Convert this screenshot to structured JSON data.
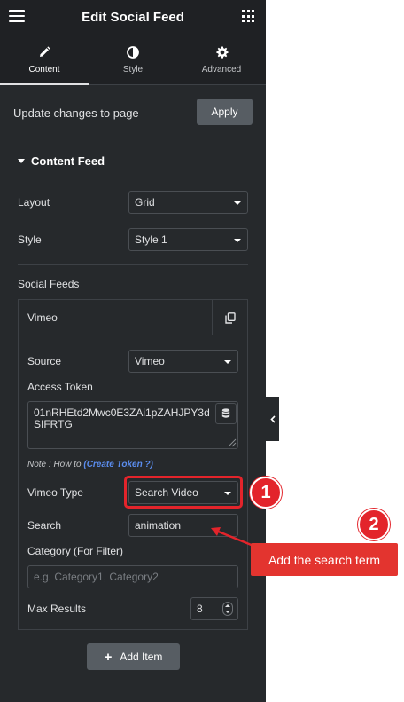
{
  "header": {
    "title": "Edit Social Feed",
    "menu_icon": "hamburger-icon",
    "apps_icon": "grid-icon"
  },
  "tabs": [
    {
      "label": "Content",
      "icon": "pencil-icon",
      "active": true
    },
    {
      "label": "Style",
      "icon": "half-circle-icon",
      "active": false
    },
    {
      "label": "Advanced",
      "icon": "gear-icon",
      "active": false
    }
  ],
  "update": {
    "text": "Update changes to page",
    "button": "Apply"
  },
  "section": {
    "title": "Content Feed"
  },
  "layout": {
    "label": "Layout",
    "value": "Grid"
  },
  "style": {
    "label": "Style",
    "value": "Style 1"
  },
  "social_feeds": {
    "label": "Social Feeds",
    "item_title": "Vimeo",
    "source": {
      "label": "Source",
      "value": "Vimeo"
    },
    "access_token": {
      "label": "Access Token",
      "value": "01nRHEtd2Mwc0E3ZAi1pZAHJPY3dSIFRTG"
    },
    "note": {
      "prefix": "Note : How to ",
      "link": "(Create Token ?)"
    },
    "vimeo_type": {
      "label": "Vimeo Type",
      "value": "Search Video"
    },
    "search": {
      "label": "Search",
      "value": "animation"
    },
    "category": {
      "label": "Category (For Filter)",
      "placeholder": "e.g. Category1, Category2"
    },
    "max_results": {
      "label": "Max Results",
      "value": "8"
    }
  },
  "add_item": {
    "label": "Add Item"
  },
  "annotations": {
    "badge1": "1",
    "badge2": "2",
    "callout": "Add the search term",
    "color": "#e3242b"
  }
}
